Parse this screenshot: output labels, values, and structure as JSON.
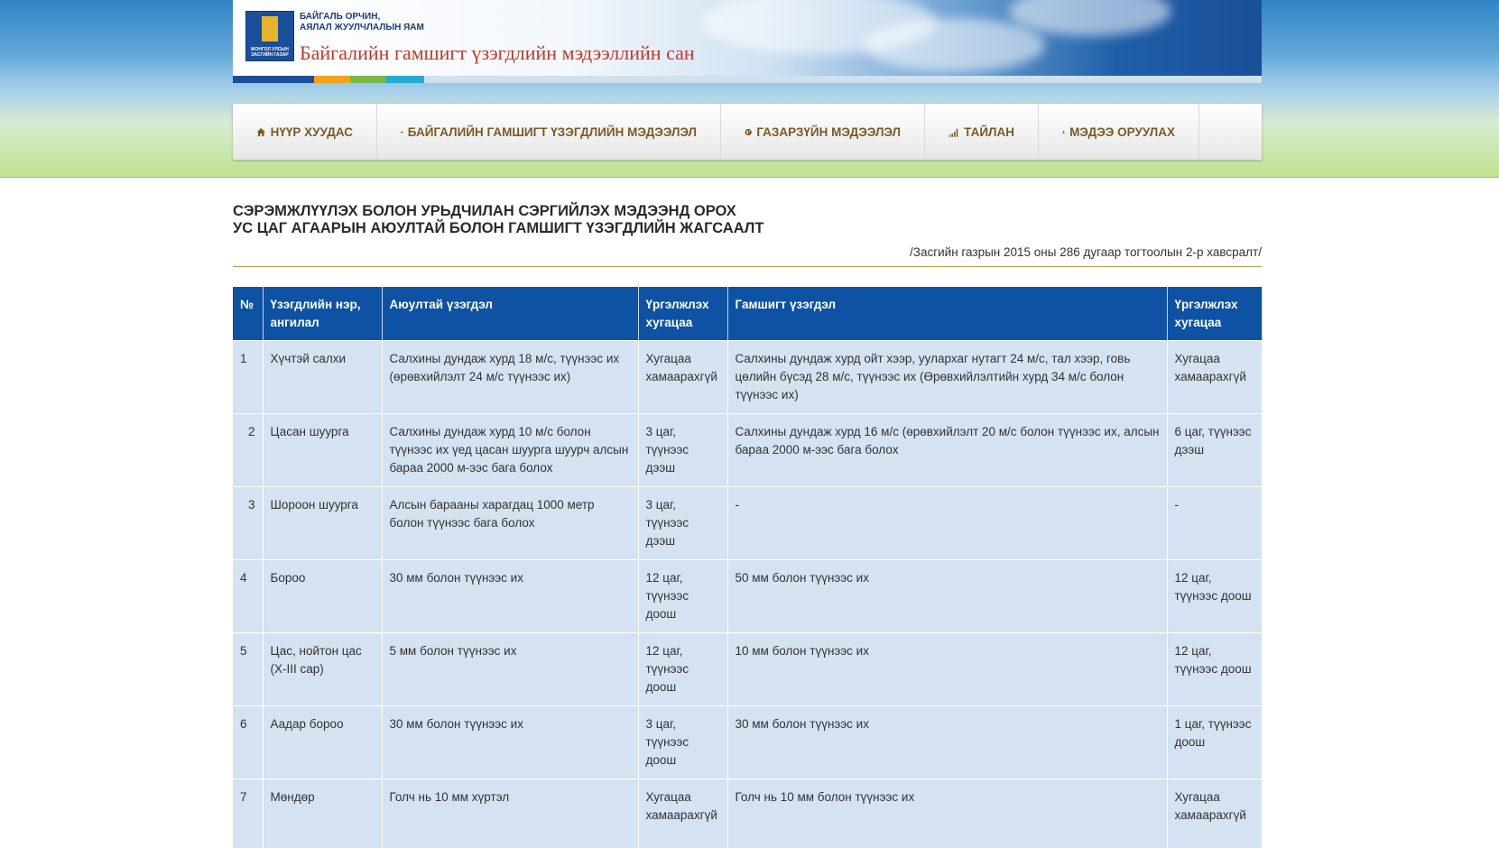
{
  "header": {
    "ministry": "БАЙГАЛЬ ОРЧИН,\nАЯЛАЛ ЖУУЛЧЛАЛЫН ЯАМ",
    "emblem_text": "МОНГОЛ УЛСЫН ЗАСГИЙН ГАЗАР",
    "site_title": "Байгалийн гамшигт үзэгдлийн мэдээллийн сан"
  },
  "nav": [
    {
      "label": "НҮҮР ХУУДАС",
      "icon": "home-icon"
    },
    {
      "label": "БАЙГАЛИЙН ГАМШИГТ ҮЗЭГДЛИЙН МЭДЭЭЛЭЛ",
      "icon": "folder-open-icon"
    },
    {
      "label": "ГАЗАРЗҮЙН МЭДЭЭЛЭЛ",
      "icon": "globe-icon"
    },
    {
      "label": "ТАЙЛАН",
      "icon": "signal-icon"
    },
    {
      "label": "МЭДЭЭ ОРУУЛАХ",
      "icon": "user-icon"
    }
  ],
  "page": {
    "title_line1": "СЭРЭМЖЛҮҮЛЭХ БОЛОН УРЬДЧИЛАН СЭРГИЙЛЭХ МЭДЭЭНД ОРОХ",
    "title_line2": "УС ЦАГ АГААРЫН АЮУЛТАЙ БОЛОН ГАМШИГТ ҮЗЭГДЛИЙН ЖАГСААЛТ",
    "subtitle": "/Засгийн газрын 2015 оны 286 дугаар тогтоолын 2-р хавсралт/"
  },
  "table": {
    "headers": [
      "№",
      "Үзэгдлийн нэр, ангилал",
      "Аюултай үзэгдэл",
      "Үргэлжлэх хугацаа",
      "Гамшигт үзэгдэл",
      "Үргэлжлэх хугацаа"
    ],
    "rows": [
      [
        "1",
        "Хүчтэй салхи",
        "Салхины дундаж хурд 18 м/с, түүнээс их (өрөвхийлэлт 24 м/с  түүнээс их)",
        "Хугацаа хамаарахгүй",
        "Салхины дундаж хурд ойт хээр, уулархаг нутагт 24 м/с, тал хээр, говь цөлийн бүсэд 28 м/с, түүнээс их (Өрөвхийлэлтийн хурд 34 м/с болон түүнээс их)",
        "Хугацаа хамаарахгүй"
      ],
      [
        "2",
        "Цасан шуурга",
        "Салхины дундаж хурд 10 м/с болон түүнээс их үед цасан шуурга шуурч алсын бараа 2000 м-ээс бага болох",
        "3 цаг, түүнээс дээш",
        "Салхины дундаж хурд 16 м/с (өрөвхийлэлт 20 м/с болон түүнээс их, алсын бараа 2000   м-ээс бага болох",
        "6 цаг,   түүнээс дээш"
      ],
      [
        "3",
        "Шороон шуурга",
        "Алсын барааны харагдац 1000 метр болон түүнээс бага болох",
        "3 цаг, түүнээс дээш",
        "-",
        "-"
      ],
      [
        "4",
        "Бороо",
        "30 мм болон түүнээс их",
        "12 цаг, түүнээс доош",
        "50 мм болон түүнээс их",
        "12 цаг, түүнээс доош"
      ],
      [
        "5",
        "Цас, нойтон цас (X-III сар)",
        "5 мм болон түүнээс их",
        "12 цаг, түүнээс доош",
        "10 мм болон түүнээс их",
        "12 цаг, түүнээс доош"
      ],
      [
        "6",
        "Аадар бороо",
        "30 мм болон түүнээс их",
        "3 цаг, түүнээс доош",
        "30 мм болон түүнээс их",
        "1 цаг, түүнээс доош"
      ],
      [
        "7",
        "Мөндөр",
        "Голч нь 10 мм хүртэл",
        "Хугацаа хамаарахгүй",
        "Голч нь 10 мм болон түүнээс их",
        "Хугацаа хамаарахгүй"
      ]
    ]
  },
  "colors": {
    "nav_text": "#7a5a24",
    "table_header": "#0d52a3",
    "table_cell": "#d4e2f1",
    "title_red": "#c0392b",
    "rule": "#c49a4c"
  }
}
